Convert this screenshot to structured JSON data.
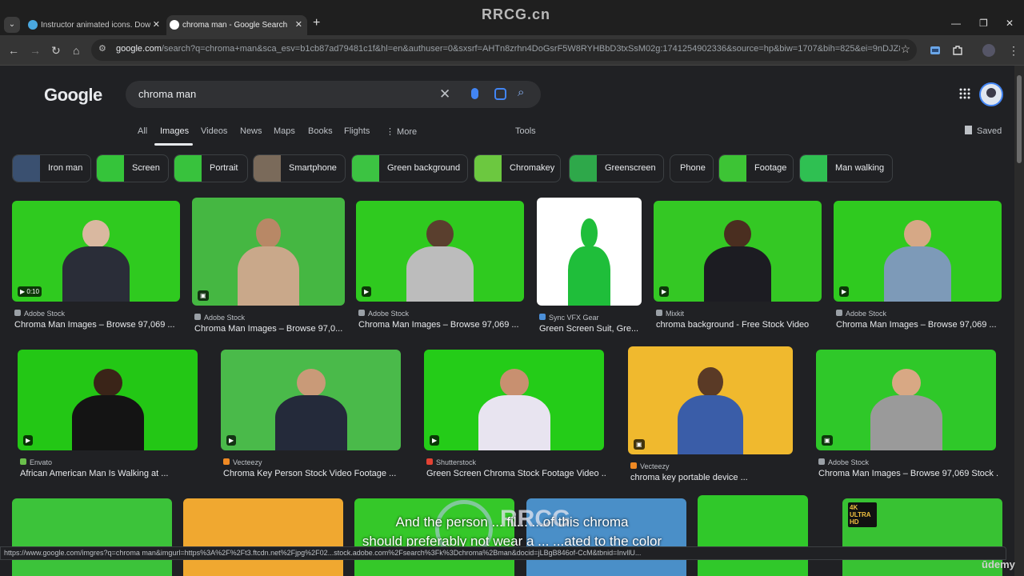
{
  "browser": {
    "tabs": [
      {
        "title": "Instructor animated icons. Dow",
        "favicon_color": "#4aa8e0"
      },
      {
        "title": "chroma man - Google Search",
        "favicon_color": "#ffffff"
      }
    ],
    "url_host": "google.com",
    "url_path": "/search?q=chroma+man&sca_esv=b1cb87ad79481c1f&hl=en&authuser=0&sxsrf=AHTn8zrhn4DoGsrF5W8RYHBbD3txSsM02g:1741254902336&source=hp&biw=1707&bih=825&ei=9nDJZ8egEar...",
    "watermark_top": "RRCG.cn"
  },
  "google": {
    "logo": "Google",
    "query": "chroma man",
    "tabs": [
      "All",
      "Images",
      "Videos",
      "News",
      "Maps",
      "Books",
      "Flights",
      "⋮ More",
      "Tools"
    ],
    "active_tab": "Images",
    "saved_label": "Saved",
    "chips": [
      {
        "label": "Iron man",
        "color": "#3a5070"
      },
      {
        "label": "Screen",
        "color": "#35c43a"
      },
      {
        "label": "Portrait",
        "color": "#38c23d"
      },
      {
        "label": "Smartphone",
        "color": "#7a6a5a"
      },
      {
        "label": "Green background",
        "color": "#3cc342"
      },
      {
        "label": "Chromakey",
        "color": "#6cc840"
      },
      {
        "label": "Greenscreen",
        "color": "#2ea84a"
      },
      {
        "label": "Phone",
        "color": ""
      },
      {
        "label": "Footage",
        "color": "#3dc435"
      },
      {
        "label": "Man walking",
        "color": "#2fc052"
      }
    ],
    "results_row1": [
      {
        "source": "Adobe Stock",
        "title": "Chroma Man Images – Browse 97,069 ...",
        "badge": "▶ 0:10",
        "bg": "#2fca1f",
        "skin": "#d9b8a0",
        "clothes": "#2a2d38",
        "src_color": "#9aa0a6"
      },
      {
        "source": "Adobe Stock",
        "title": "Chroma Man Images – Browse 97,0...",
        "badge": "▣",
        "bg": "#45b742",
        "skin": "#b88866",
        "clothes": "#c9a88a",
        "src_color": "#9aa0a6"
      },
      {
        "source": "Adobe Stock",
        "title": "Chroma Man Images – Browse 97,069 ...",
        "badge": "▶",
        "bg": "#2fca1f",
        "skin": "#5a3f2e",
        "clothes": "#bcbcbc",
        "src_color": "#9aa0a6"
      },
      {
        "source": "Sync VFX Gear",
        "title": "Green Screen Suit, Gre...",
        "badge": "",
        "bg": "#ffffff",
        "skin": "#1fbe3a",
        "clothes": "#1fbe3a",
        "src_color": "#4b8fd9"
      },
      {
        "source": "Mixkit",
        "title": "chroma background - Free Stock Video",
        "badge": "▶",
        "bg": "#34c824",
        "skin": "#4a2e20",
        "clothes": "#1c1c22",
        "src_color": "#9aa0a6"
      },
      {
        "source": "Adobe Stock",
        "title": "Chroma Man Images – Browse 97,069 ...",
        "badge": "▶",
        "bg": "#2fca1f",
        "skin": "#d6a886",
        "clothes": "#7d9ab8",
        "src_color": "#9aa0a6"
      }
    ],
    "results_row2": [
      {
        "source": "Envato",
        "title": "African American Man Is Walking at ...",
        "badge": "▶",
        "bg": "#23c715",
        "skin": "#3a2418",
        "clothes": "#141414",
        "src_color": "#6abf4b"
      },
      {
        "source": "Vecteezy",
        "title": "Chroma Key Person Stock Video Footage ...",
        "badge": "▶",
        "bg": "#4aba4a",
        "skin": "#c99a78",
        "clothes": "#242a3a",
        "src_color": "#f08a24"
      },
      {
        "source": "Shutterstock",
        "title": "Green Screen Chroma Stock Footage Video ...",
        "badge": "▶",
        "bg": "#24cc18",
        "skin": "#c89070",
        "clothes": "#e8e4f0",
        "src_color": "#e34234"
      },
      {
        "source": "Vecteezy",
        "title": "chroma key portable device ...",
        "badge": "▣",
        "bg": "#f0b92e",
        "skin": "#5a3a26",
        "clothes": "#3a5da8",
        "src_color": "#f08a24"
      },
      {
        "source": "Adobe Stock",
        "title": "Chroma Man Images – Browse 97,069 Stock ...",
        "badge": "▣",
        "bg": "#2fc829",
        "skin": "#d8a884",
        "clothes": "#9a9a9a",
        "src_color": "#9aa0a6"
      }
    ],
    "results_row3_colors": [
      "#3cc33a",
      "#f0a830",
      "#35c829",
      "#4a8fc8",
      "#30c82a",
      "#38c233"
    ],
    "row3_badge": "4K ULTRA HD"
  },
  "subtitle_lines": [
    "And the person ... fil... ...of this chroma",
    "should preferably not wear a ... ...ated to the color"
  ],
  "watermark_center": "RRCG",
  "status_url": "https://www.google.com/imgres?q=chroma man&imgurl=https%3A%2F%2Ft3.ftcdn.net%2Fjpg%2F02...stock.adobe.com%2Fsearch%3Fk%3Dchroma%2Bman&docid=jLBgB846of-CcM&tbnid=InvllU...",
  "corner_brand": "ūdemy"
}
